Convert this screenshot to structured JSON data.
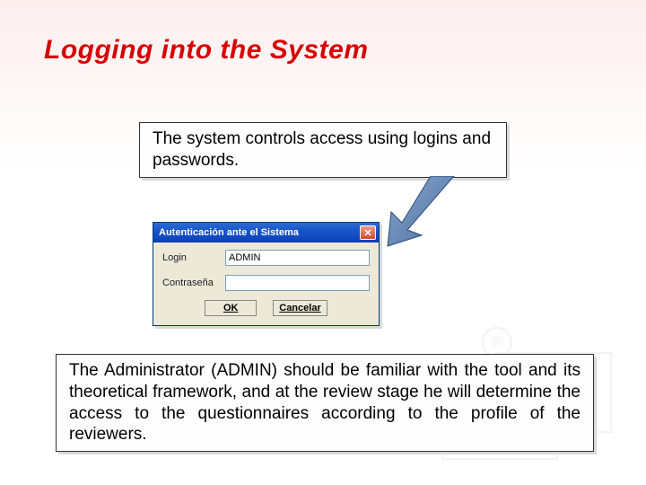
{
  "title": "Logging into the System",
  "text_top": "The system controls access using logins and passwords.",
  "text_bottom": "The Administrator (ADMIN) should be familiar with the tool and its theoretical framework, and at the review stage he will determine the access to the questionnaires according to the profile of the reviewers.",
  "dialog": {
    "title": "Autenticación ante el Sistema",
    "login_label": "Login",
    "login_value": "ADMIN",
    "password_label": "Contraseña",
    "password_value": "",
    "ok_label": "OK",
    "cancel_label": "Cancelar",
    "close_glyph": "✕"
  },
  "deco_symbol": "®"
}
